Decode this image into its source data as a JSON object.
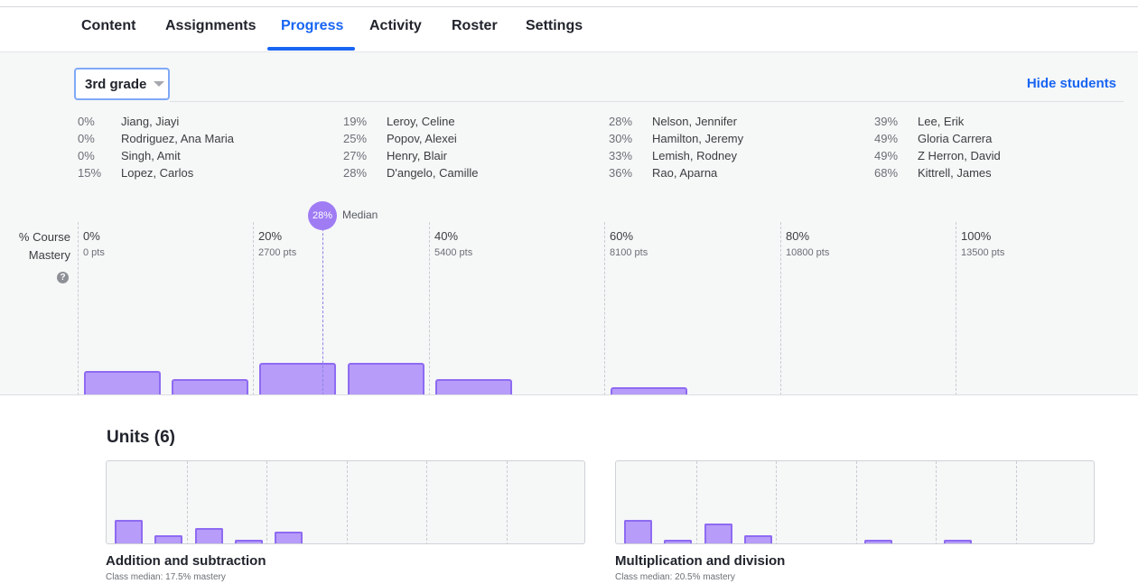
{
  "nav": {
    "tabs": [
      {
        "label": "Content"
      },
      {
        "label": "Assignments"
      },
      {
        "label": "Progress"
      },
      {
        "label": "Activity"
      },
      {
        "label": "Roster"
      },
      {
        "label": "Settings"
      }
    ],
    "active_tab": "Progress"
  },
  "filter": {
    "grade": "3rd grade",
    "hide_students": "Hide students"
  },
  "students": [
    {
      "pct": "0%",
      "name": "Jiang, Jiayi"
    },
    {
      "pct": "0%",
      "name": "Rodriguez, Ana Maria"
    },
    {
      "pct": "0%",
      "name": "Singh, Amit"
    },
    {
      "pct": "15%",
      "name": "Lopez, Carlos"
    },
    {
      "pct": "19%",
      "name": "Leroy, Celine"
    },
    {
      "pct": "25%",
      "name": "Popov, Alexei"
    },
    {
      "pct": "27%",
      "name": "Henry, Blair"
    },
    {
      "pct": "28%",
      "name": "D'angelo, Camille"
    },
    {
      "pct": "28%",
      "name": "Nelson, Jennifer"
    },
    {
      "pct": "30%",
      "name": "Hamilton, Jeremy"
    },
    {
      "pct": "33%",
      "name": "Lemish, Rodney"
    },
    {
      "pct": "36%",
      "name": "Rao, Aparna"
    },
    {
      "pct": "39%",
      "name": "Lee, Erik"
    },
    {
      "pct": "49%",
      "name": "Gloria Carrera"
    },
    {
      "pct": "49%",
      "name": "Z Herron, David"
    },
    {
      "pct": "68%",
      "name": "Kittrell, James"
    }
  ],
  "mastery": {
    "title_line1": "% Course",
    "title_line2": "Mastery",
    "help_icon": "?",
    "median_badge": "28%",
    "median_label": "Median",
    "median_value": 28
  },
  "chart_data": {
    "type": "bar",
    "columns": [
      {
        "label": "0%",
        "pts": "0 pts"
      },
      {
        "label": "20%",
        "pts": "2700 pts"
      },
      {
        "label": "40%",
        "pts": "5400 pts"
      },
      {
        "label": "60%",
        "pts": "8100 pts"
      },
      {
        "label": "80%",
        "pts": "10800 pts"
      },
      {
        "label": "100%",
        "pts": "13500 pts"
      }
    ],
    "bins": [
      "0-10%",
      "10-20%",
      "20-30%",
      "30-40%",
      "40-50%",
      "50-60%",
      "60-70%",
      "70-80%",
      "80-90%",
      "90-100%"
    ],
    "values": [
      3,
      2,
      4,
      4,
      2,
      0,
      1,
      0,
      0,
      0
    ],
    "max_count": 4
  },
  "units": {
    "title": "Units (6)",
    "items": [
      {
        "name": "Addition and subtraction",
        "median": "Class median: 17.5% mastery",
        "bins": [
          3,
          1,
          2,
          0.3,
          1.5,
          0,
          0,
          0,
          0,
          0
        ]
      },
      {
        "name": "Multiplication and division",
        "median": "Class median: 20.5% mastery",
        "bins": [
          3,
          0.5,
          2.5,
          1,
          0,
          0,
          0.5,
          0,
          0.5,
          0
        ]
      }
    ]
  },
  "colors": {
    "accent": "#1865f2",
    "bar_fill": "#b79cf9",
    "bar_stroke": "#8e6bf2",
    "median": "#9f7cf4"
  }
}
